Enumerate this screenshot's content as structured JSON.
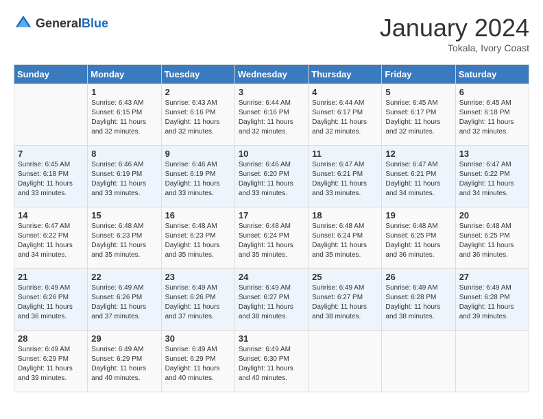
{
  "header": {
    "logo_general": "General",
    "logo_blue": "Blue",
    "month_title": "January 2024",
    "subtitle": "Tokala, Ivory Coast"
  },
  "days_of_week": [
    "Sunday",
    "Monday",
    "Tuesday",
    "Wednesday",
    "Thursday",
    "Friday",
    "Saturday"
  ],
  "weeks": [
    [
      {
        "day": "",
        "sunrise": "",
        "sunset": "",
        "daylight": ""
      },
      {
        "day": "1",
        "sunrise": "Sunrise: 6:43 AM",
        "sunset": "Sunset: 6:15 PM",
        "daylight": "Daylight: 11 hours and 32 minutes."
      },
      {
        "day": "2",
        "sunrise": "Sunrise: 6:43 AM",
        "sunset": "Sunset: 6:16 PM",
        "daylight": "Daylight: 11 hours and 32 minutes."
      },
      {
        "day": "3",
        "sunrise": "Sunrise: 6:44 AM",
        "sunset": "Sunset: 6:16 PM",
        "daylight": "Daylight: 11 hours and 32 minutes."
      },
      {
        "day": "4",
        "sunrise": "Sunrise: 6:44 AM",
        "sunset": "Sunset: 6:17 PM",
        "daylight": "Daylight: 11 hours and 32 minutes."
      },
      {
        "day": "5",
        "sunrise": "Sunrise: 6:45 AM",
        "sunset": "Sunset: 6:17 PM",
        "daylight": "Daylight: 11 hours and 32 minutes."
      },
      {
        "day": "6",
        "sunrise": "Sunrise: 6:45 AM",
        "sunset": "Sunset: 6:18 PM",
        "daylight": "Daylight: 11 hours and 32 minutes."
      }
    ],
    [
      {
        "day": "7",
        "sunrise": "Sunrise: 6:45 AM",
        "sunset": "Sunset: 6:18 PM",
        "daylight": "Daylight: 11 hours and 33 minutes."
      },
      {
        "day": "8",
        "sunrise": "Sunrise: 6:46 AM",
        "sunset": "Sunset: 6:19 PM",
        "daylight": "Daylight: 11 hours and 33 minutes."
      },
      {
        "day": "9",
        "sunrise": "Sunrise: 6:46 AM",
        "sunset": "Sunset: 6:19 PM",
        "daylight": "Daylight: 11 hours and 33 minutes."
      },
      {
        "day": "10",
        "sunrise": "Sunrise: 6:46 AM",
        "sunset": "Sunset: 6:20 PM",
        "daylight": "Daylight: 11 hours and 33 minutes."
      },
      {
        "day": "11",
        "sunrise": "Sunrise: 6:47 AM",
        "sunset": "Sunset: 6:21 PM",
        "daylight": "Daylight: 11 hours and 33 minutes."
      },
      {
        "day": "12",
        "sunrise": "Sunrise: 6:47 AM",
        "sunset": "Sunset: 6:21 PM",
        "daylight": "Daylight: 11 hours and 34 minutes."
      },
      {
        "day": "13",
        "sunrise": "Sunrise: 6:47 AM",
        "sunset": "Sunset: 6:22 PM",
        "daylight": "Daylight: 11 hours and 34 minutes."
      }
    ],
    [
      {
        "day": "14",
        "sunrise": "Sunrise: 6:47 AM",
        "sunset": "Sunset: 6:22 PM",
        "daylight": "Daylight: 11 hours and 34 minutes."
      },
      {
        "day": "15",
        "sunrise": "Sunrise: 6:48 AM",
        "sunset": "Sunset: 6:23 PM",
        "daylight": "Daylight: 11 hours and 35 minutes."
      },
      {
        "day": "16",
        "sunrise": "Sunrise: 6:48 AM",
        "sunset": "Sunset: 6:23 PM",
        "daylight": "Daylight: 11 hours and 35 minutes."
      },
      {
        "day": "17",
        "sunrise": "Sunrise: 6:48 AM",
        "sunset": "Sunset: 6:24 PM",
        "daylight": "Daylight: 11 hours and 35 minutes."
      },
      {
        "day": "18",
        "sunrise": "Sunrise: 6:48 AM",
        "sunset": "Sunset: 6:24 PM",
        "daylight": "Daylight: 11 hours and 35 minutes."
      },
      {
        "day": "19",
        "sunrise": "Sunrise: 6:48 AM",
        "sunset": "Sunset: 6:25 PM",
        "daylight": "Daylight: 11 hours and 36 minutes."
      },
      {
        "day": "20",
        "sunrise": "Sunrise: 6:48 AM",
        "sunset": "Sunset: 6:25 PM",
        "daylight": "Daylight: 11 hours and 36 minutes."
      }
    ],
    [
      {
        "day": "21",
        "sunrise": "Sunrise: 6:49 AM",
        "sunset": "Sunset: 6:26 PM",
        "daylight": "Daylight: 11 hours and 36 minutes."
      },
      {
        "day": "22",
        "sunrise": "Sunrise: 6:49 AM",
        "sunset": "Sunset: 6:26 PM",
        "daylight": "Daylight: 11 hours and 37 minutes."
      },
      {
        "day": "23",
        "sunrise": "Sunrise: 6:49 AM",
        "sunset": "Sunset: 6:26 PM",
        "daylight": "Daylight: 11 hours and 37 minutes."
      },
      {
        "day": "24",
        "sunrise": "Sunrise: 6:49 AM",
        "sunset": "Sunset: 6:27 PM",
        "daylight": "Daylight: 11 hours and 38 minutes."
      },
      {
        "day": "25",
        "sunrise": "Sunrise: 6:49 AM",
        "sunset": "Sunset: 6:27 PM",
        "daylight": "Daylight: 11 hours and 38 minutes."
      },
      {
        "day": "26",
        "sunrise": "Sunrise: 6:49 AM",
        "sunset": "Sunset: 6:28 PM",
        "daylight": "Daylight: 11 hours and 38 minutes."
      },
      {
        "day": "27",
        "sunrise": "Sunrise: 6:49 AM",
        "sunset": "Sunset: 6:28 PM",
        "daylight": "Daylight: 11 hours and 39 minutes."
      }
    ],
    [
      {
        "day": "28",
        "sunrise": "Sunrise: 6:49 AM",
        "sunset": "Sunset: 6:29 PM",
        "daylight": "Daylight: 11 hours and 39 minutes."
      },
      {
        "day": "29",
        "sunrise": "Sunrise: 6:49 AM",
        "sunset": "Sunset: 6:29 PM",
        "daylight": "Daylight: 11 hours and 40 minutes."
      },
      {
        "day": "30",
        "sunrise": "Sunrise: 6:49 AM",
        "sunset": "Sunset: 6:29 PM",
        "daylight": "Daylight: 11 hours and 40 minutes."
      },
      {
        "day": "31",
        "sunrise": "Sunrise: 6:49 AM",
        "sunset": "Sunset: 6:30 PM",
        "daylight": "Daylight: 11 hours and 40 minutes."
      },
      {
        "day": "",
        "sunrise": "",
        "sunset": "",
        "daylight": ""
      },
      {
        "day": "",
        "sunrise": "",
        "sunset": "",
        "daylight": ""
      },
      {
        "day": "",
        "sunrise": "",
        "sunset": "",
        "daylight": ""
      }
    ]
  ]
}
